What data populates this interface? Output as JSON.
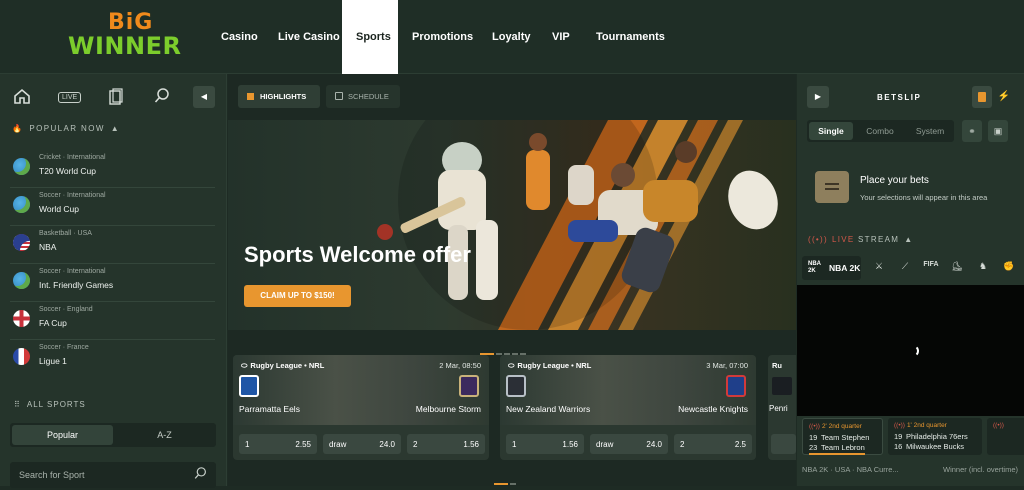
{
  "brand": {
    "big": "BiG",
    "winner": "WINNER"
  },
  "nav": {
    "items": [
      "Casino",
      "Live Casino",
      "Sports",
      "Promotions",
      "Loyalty",
      "VIP",
      "Tournaments"
    ],
    "active": "Sports"
  },
  "left": {
    "live_label": "LIVE",
    "popular_title": "POPULAR NOW",
    "popular": [
      {
        "sub": "Cricket · International",
        "name": "T20 World Cup",
        "flag": "globe"
      },
      {
        "sub": "Soccer · International",
        "name": "World Cup",
        "flag": "globe"
      },
      {
        "sub": "Basketball · USA",
        "name": "NBA",
        "flag": "usa"
      },
      {
        "sub": "Soccer · International",
        "name": "Int. Friendly Games",
        "flag": "globe"
      },
      {
        "sub": "Soccer · England",
        "name": "FA Cup",
        "flag": "england"
      },
      {
        "sub": "Soccer · France",
        "name": "Ligue 1",
        "flag": "france"
      }
    ],
    "all_sports": "ALL SPORTS",
    "seg_popular": "Popular",
    "seg_az": "A-Z",
    "search_placeholder": "Search for Sport"
  },
  "center": {
    "tab_highlights": "HIGHLIGHTS",
    "tab_schedule": "SCHEDULE",
    "hero_title": "Sports Welcome offer",
    "hero_cta": "CLAIM UP TO $150!",
    "cards": [
      {
        "league": "Rugby League • NRL",
        "date": "2 Mar, 08:50",
        "home": "Parramatta Eels",
        "away": "Melbourne Storm",
        "odds": [
          {
            "label": "1",
            "value": "2.55"
          },
          {
            "label": "draw",
            "value": "24.0"
          },
          {
            "label": "2",
            "value": "1.56"
          }
        ]
      },
      {
        "league": "Rugby League • NRL",
        "date": "3 Mar, 07:00",
        "home": "New Zealand Warriors",
        "away": "Newcastle Knights",
        "odds": [
          {
            "label": "1",
            "value": "1.56"
          },
          {
            "label": "draw",
            "value": "24.0"
          },
          {
            "label": "2",
            "value": "2.5"
          }
        ]
      }
    ],
    "card3_fragment": "Ru",
    "card3_team_fragment": "Penri"
  },
  "betslip": {
    "title": "BETSLIP",
    "tabs": [
      "Single",
      "Combo",
      "System"
    ],
    "empty_title": "Place your bets",
    "empty_sub": "Your selections will appear in this area"
  },
  "livestream": {
    "title_live": "LIVE",
    "title_rest": "STREAM",
    "active_tab": "NBA 2K",
    "tab_icon_text": "NBA\n2K",
    "live_games": [
      {
        "quarter": "2' 2nd quarter",
        "rows": [
          {
            "score": "19",
            "team": "Team Stephen"
          },
          {
            "score": "23",
            "team": "Team Lebron"
          }
        ]
      },
      {
        "quarter": "1' 2nd quarter",
        "rows": [
          {
            "score": "19",
            "team": "Philadelphia 76ers"
          },
          {
            "score": "16",
            "team": "Milwaukee Bucks"
          }
        ]
      }
    ],
    "info": "NBA 2K · USA · NBA Curre...",
    "market": "Winner (incl. overtime)"
  },
  "colors": {
    "accent": "#e8962f",
    "live_red": "#d4584a",
    "bg": "#1e2b24"
  }
}
